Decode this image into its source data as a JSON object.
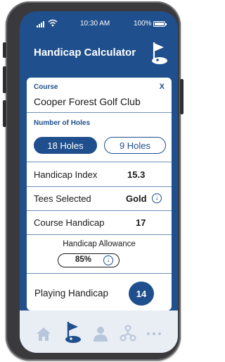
{
  "status_bar": {
    "time": "10:30 AM",
    "battery": "100%",
    "icons": [
      "signal-icon",
      "wifi-icon",
      "battery-icon"
    ]
  },
  "header": {
    "title": "Handicap Calculator",
    "icon": "golf-flag-icon"
  },
  "course": {
    "label": "Course",
    "name": "Cooper Forest Golf Club",
    "close_label": "X"
  },
  "holes": {
    "label": "Number of Holes",
    "options": [
      "18 Holes",
      "9 Holes"
    ],
    "selected": "18 Holes"
  },
  "handicap_index": {
    "label": "Handicap Index",
    "value": "15.3"
  },
  "tees": {
    "label": "Tees Selected",
    "value": "Gold",
    "icon": "chevron-down-circle-icon"
  },
  "course_handicap": {
    "label": "Course Handicap",
    "value": "17"
  },
  "allowance": {
    "label": "Handicap Allowance",
    "value": "85%",
    "icon": "chevron-down-circle-icon"
  },
  "playing_handicap": {
    "label": "Playing Handicap",
    "value": "14"
  },
  "bottom_nav": {
    "items": [
      "home-icon",
      "golf-flag-icon",
      "profile-icon",
      "network-icon",
      "more-icon"
    ],
    "active": "golf-flag-icon"
  },
  "colors": {
    "primary": "#1f4f8c",
    "card": "#ffffff",
    "nav_background": "#e9eef5",
    "nav_inactive": "#b7c6da"
  }
}
